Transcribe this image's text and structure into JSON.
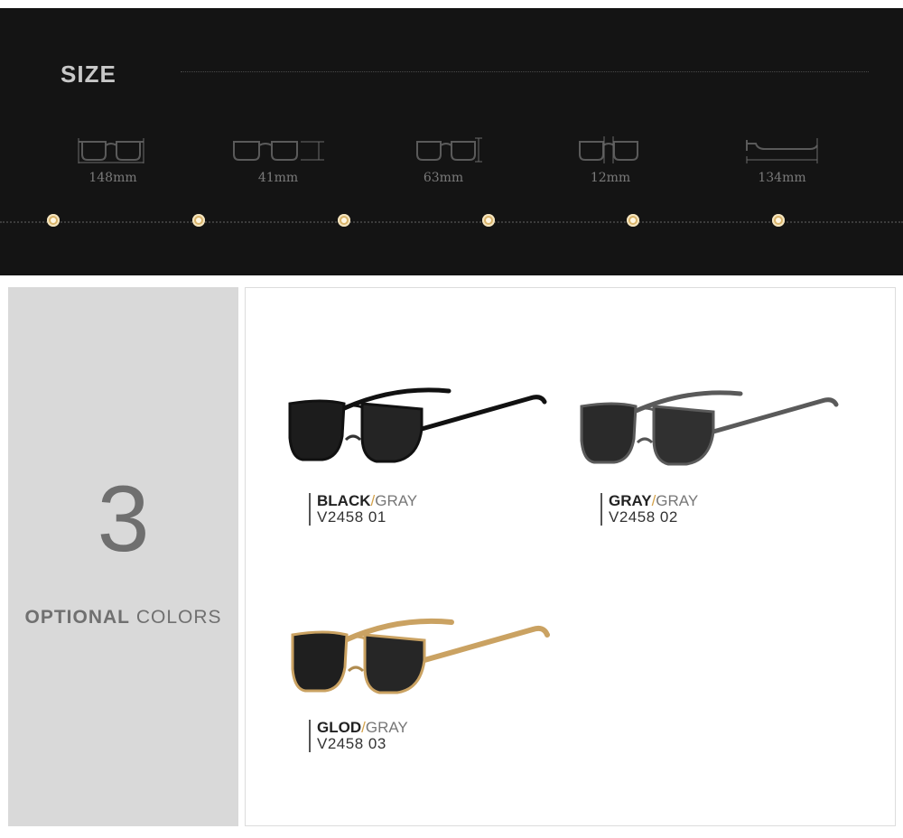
{
  "size": {
    "title": "SIZE",
    "measurements": [
      {
        "icon": "frame-width-icon",
        "value": "148mm"
      },
      {
        "icon": "lens-width-icon",
        "value": "41mm"
      },
      {
        "icon": "lens-height-icon",
        "value": "63mm"
      },
      {
        "icon": "bridge-width-icon",
        "value": "12mm"
      },
      {
        "icon": "temple-length-icon",
        "value": "134mm"
      }
    ],
    "accent": "#d9b46a"
  },
  "colors": {
    "count": "3",
    "label_bold": "OPTIONAL",
    "label_light": "COLORS",
    "products": [
      {
        "frame": "BLACK",
        "lens": "GRAY",
        "code": "V2458  01",
        "frame_color": "#111111"
      },
      {
        "frame": "GRAY",
        "lens": "GRAY",
        "code": "V2458  02",
        "frame_color": "#5a5a5a"
      },
      {
        "frame": "GLOD",
        "lens": "GRAY",
        "code": "V2458  03",
        "frame_color": "#caa262"
      }
    ],
    "slash_color": "#d4a24a"
  }
}
